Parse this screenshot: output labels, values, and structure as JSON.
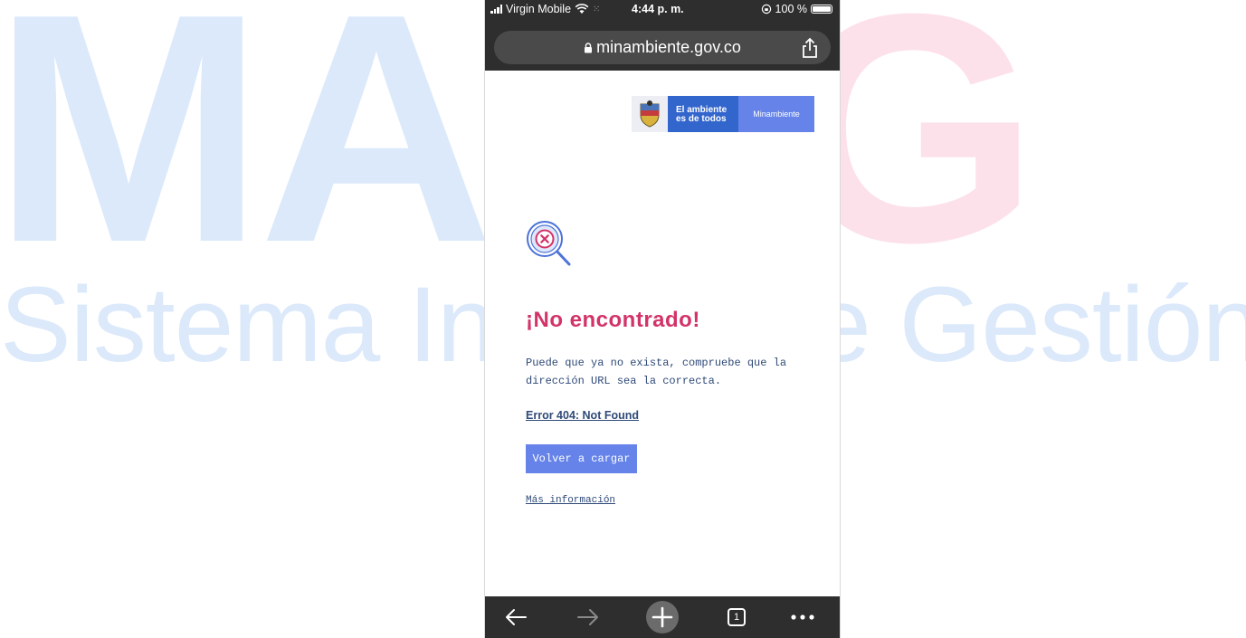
{
  "background": {
    "watermark_a": "MA",
    "watermark_b": "SIG",
    "watermark_sub": "Sistema Int          e Gestión"
  },
  "status_bar": {
    "carrier": "Virgin Mobile",
    "time": "4:44 p. m.",
    "battery": "100 %"
  },
  "browser": {
    "url": "minambiente.gov.co"
  },
  "page": {
    "logo": {
      "slogan_line1": "El ambiente",
      "slogan_line2": "es de todos",
      "ministry": "Minambiente"
    },
    "title": "¡No encontrado!",
    "description": "Puede que ya no exista, compruebe que la dirección URL sea la correcta.",
    "error_link": "Error 404: Not Found",
    "reload_button": "Volver a cargar",
    "more_info_link": "Más información"
  },
  "toolbar": {
    "tab_count": "1"
  },
  "colors": {
    "accent_red": "#d33467",
    "button_blue": "#6583e8",
    "logo_blue": "#3366cc",
    "text_blue": "#2f4a78",
    "browser_chrome": "#2e2e2e"
  }
}
